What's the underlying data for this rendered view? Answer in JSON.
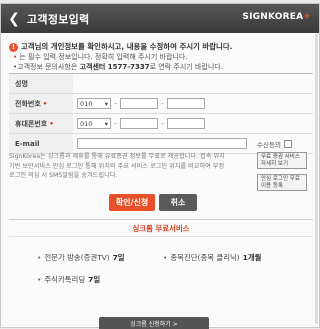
{
  "window": {
    "title": "고객정보입력",
    "logo": "SIGNKOREA",
    "logo_mark": "+"
  },
  "notice": {
    "heading": "고객님의 개인정보를 확인하시고, 내용을 수정하여 주시기 바랍니다.",
    "required_mark": "•",
    "line1": "는 필수 입력 정보입니다. 정확히 입력해 주시기 바랍니다.",
    "line2_prefix": "•고객정보 문의사항은",
    "line2_phone": "고객센터 1577-7337",
    "line2_suffix": "로 연락 주시기 바랍니다."
  },
  "form": {
    "header_label": "성명",
    "phone_label": "전화번호",
    "mobile_label": "휴대폰번호",
    "required_mark": "•",
    "phone_prefix": "010",
    "mobile_prefix": "010",
    "dash": "-",
    "email_label": "E-mail",
    "agree_label": "수신동의"
  },
  "info_text": "SignKorea는 싱크롬과 제휴를 통해 유료증권 정보를 무료로 제공합니다. 접속 위치기반 보안서비스 안심 로그인 통해 위치와 주요 서비스 로그인 위치를 비교하여 부정 로그인 의심 시 SMS알림을 송겨드립니다.",
  "side_buttons": {
    "btn1": "무료 증권 서비스 자세히 보기",
    "btn2": "안심 로그인 무료이용 등록"
  },
  "buttons": {
    "confirm": "확인/신청",
    "cancel": "취소"
  },
  "services": {
    "title": "싱크롬 무료서비스",
    "item1": "전문가 방송(증권TV)",
    "item1_val": "7일",
    "item2": "종목진단(종목 클리닉)",
    "item2_val": "1개월",
    "item3": "주식카톡리딩",
    "item3_val": "7일",
    "bullet": "•"
  },
  "bottom_button": "싱크롬 신청하기 >"
}
